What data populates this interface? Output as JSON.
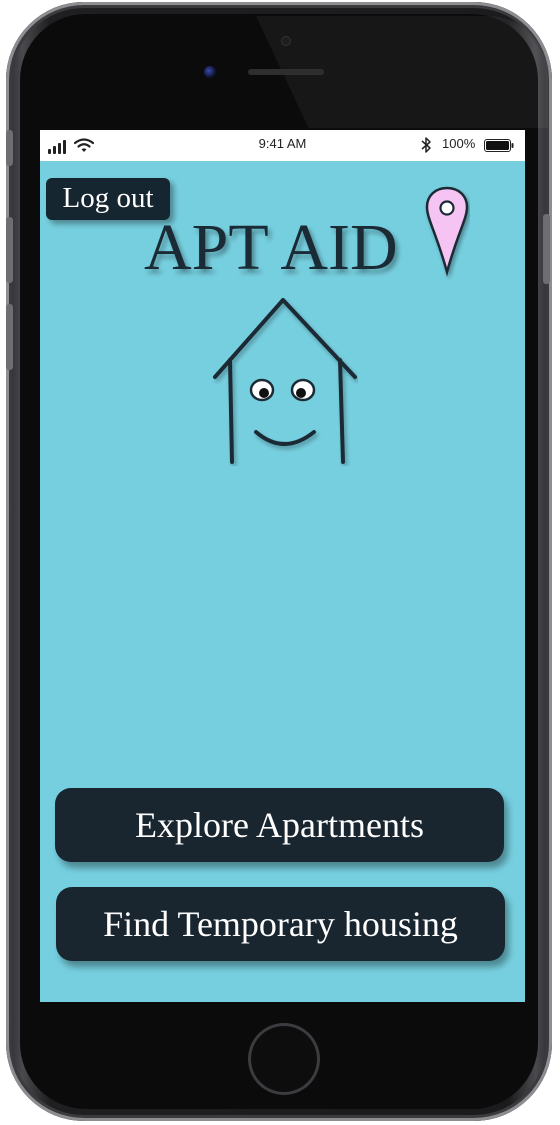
{
  "status_bar": {
    "time": "9:41 AM",
    "battery": "100%",
    "icons": [
      "signal-icon",
      "wifi-icon",
      "bluetooth-icon",
      "battery-icon"
    ]
  },
  "header": {
    "logout_label": "Log out",
    "app_title": "APT AID",
    "pin_icon": "location-pin-icon"
  },
  "mascot": {
    "icon": "smiling-house-icon"
  },
  "actions": {
    "explore_label": "Explore Apartments",
    "temporary_label": "Find Temporary housing"
  },
  "colors": {
    "screen_background": "#76cfdf",
    "button_background": "#192630",
    "button_text": "#ffffff",
    "title_text": "#1b2b36",
    "pin_fill": "#f5c4f3"
  }
}
